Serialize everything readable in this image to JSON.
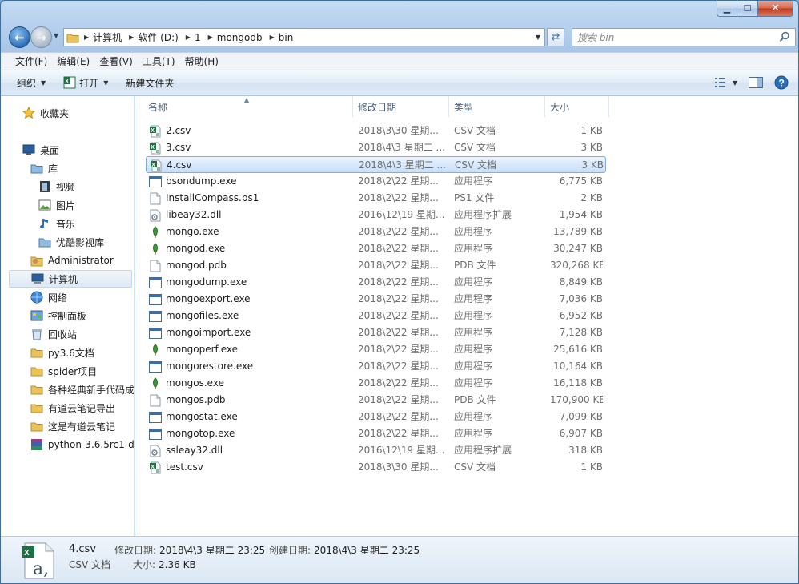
{
  "window": {
    "caption": {
      "min": "▁",
      "max": "☐",
      "close": "✕"
    }
  },
  "breadcrumb": [
    "计算机",
    "软件 (D:)",
    "1",
    "mongodb",
    "bin"
  ],
  "search": {
    "placeholder": "搜索 bin"
  },
  "menu": [
    "文件(F)",
    "编辑(E)",
    "查看(V)",
    "工具(T)",
    "帮助(H)"
  ],
  "toolbar": {
    "organize": "组织",
    "open": "打开",
    "new_folder": "新建文件夹"
  },
  "nav": {
    "favorites": "收藏夹",
    "desktop": "桌面",
    "libraries": "库",
    "videos": "视频",
    "pictures": "图片",
    "music": "音乐",
    "youku": "优酷影视库",
    "administrator": "Administrator",
    "computer": "计算机",
    "network": "网络",
    "control_panel": "控制面板",
    "recycle_bin": "回收站",
    "py36": "py3.6文档",
    "spider": "spider项目",
    "classic_code": "各种经典新手代码成",
    "youdao_export": "有道云笔记导出",
    "youdao_notes": "这是有道云笔记",
    "python_installer": "python-3.6.5rc1-do"
  },
  "columns": {
    "name": "名称",
    "date": "修改日期",
    "type": "类型",
    "size": "大小"
  },
  "files": [
    {
      "name": "2.csv",
      "date": "2018\\3\\30 星期...",
      "type": "CSV 文档",
      "size": "1 KB",
      "icon": "csv"
    },
    {
      "name": "3.csv",
      "date": "2018\\4\\3 星期二 ...",
      "type": "CSV 文档",
      "size": "3 KB",
      "icon": "csv"
    },
    {
      "name": "4.csv",
      "date": "2018\\4\\3 星期二 ...",
      "type": "CSV 文档",
      "size": "3 KB",
      "icon": "csv"
    },
    {
      "name": "bsondump.exe",
      "date": "2018\\2\\22 星期...",
      "type": "应用程序",
      "size": "6,775 KB",
      "icon": "exe"
    },
    {
      "name": "InstallCompass.ps1",
      "date": "2018\\2\\22 星期...",
      "type": "PS1 文件",
      "size": "2 KB",
      "icon": "blank"
    },
    {
      "name": "libeay32.dll",
      "date": "2016\\12\\19 星期...",
      "type": "应用程序扩展",
      "size": "1,954 KB",
      "icon": "dll"
    },
    {
      "name": "mongo.exe",
      "date": "2018\\2\\22 星期...",
      "type": "应用程序",
      "size": "13,789 KB",
      "icon": "leaf"
    },
    {
      "name": "mongod.exe",
      "date": "2018\\2\\22 星期...",
      "type": "应用程序",
      "size": "30,247 KB",
      "icon": "leaf"
    },
    {
      "name": "mongod.pdb",
      "date": "2018\\2\\22 星期...",
      "type": "PDB 文件",
      "size": "320,268 KB",
      "icon": "blank"
    },
    {
      "name": "mongodump.exe",
      "date": "2018\\2\\22 星期...",
      "type": "应用程序",
      "size": "8,849 KB",
      "icon": "exe"
    },
    {
      "name": "mongoexport.exe",
      "date": "2018\\2\\22 星期...",
      "type": "应用程序",
      "size": "7,036 KB",
      "icon": "exe"
    },
    {
      "name": "mongofiles.exe",
      "date": "2018\\2\\22 星期...",
      "type": "应用程序",
      "size": "6,952 KB",
      "icon": "exe"
    },
    {
      "name": "mongoimport.exe",
      "date": "2018\\2\\22 星期...",
      "type": "应用程序",
      "size": "7,128 KB",
      "icon": "exe"
    },
    {
      "name": "mongoperf.exe",
      "date": "2018\\2\\22 星期...",
      "type": "应用程序",
      "size": "25,616 KB",
      "icon": "leaf"
    },
    {
      "name": "mongorestore.exe",
      "date": "2018\\2\\22 星期...",
      "type": "应用程序",
      "size": "10,164 KB",
      "icon": "exe"
    },
    {
      "name": "mongos.exe",
      "date": "2018\\2\\22 星期...",
      "type": "应用程序",
      "size": "16,118 KB",
      "icon": "leaf"
    },
    {
      "name": "mongos.pdb",
      "date": "2018\\2\\22 星期...",
      "type": "PDB 文件",
      "size": "170,900 KB",
      "icon": "blank"
    },
    {
      "name": "mongostat.exe",
      "date": "2018\\2\\22 星期...",
      "type": "应用程序",
      "size": "7,099 KB",
      "icon": "exe"
    },
    {
      "name": "mongotop.exe",
      "date": "2018\\2\\22 星期...",
      "type": "应用程序",
      "size": "6,907 KB",
      "icon": "exe"
    },
    {
      "name": "ssleay32.dll",
      "date": "2016\\12\\19 星期...",
      "type": "应用程序扩展",
      "size": "318 KB",
      "icon": "dll"
    },
    {
      "name": "test.csv",
      "date": "2018\\3\\30 星期...",
      "type": "CSV 文档",
      "size": "1 KB",
      "icon": "csv"
    }
  ],
  "selected_index": 2,
  "details": {
    "name": "4.csv",
    "type": "CSV 文档",
    "modified_label": "修改日期:",
    "modified": "2018\\4\\3 星期二 23:25",
    "created_label": "创建日期:",
    "created": "2018\\4\\3 星期二 23:25",
    "size_label": "大小:",
    "size": "2.36 KB"
  },
  "colors": {
    "accent": "#2c6fb8",
    "selection": "#c8e0fa",
    "csv_green": "#1e7145",
    "leaf_green": "#3f9b3a"
  }
}
